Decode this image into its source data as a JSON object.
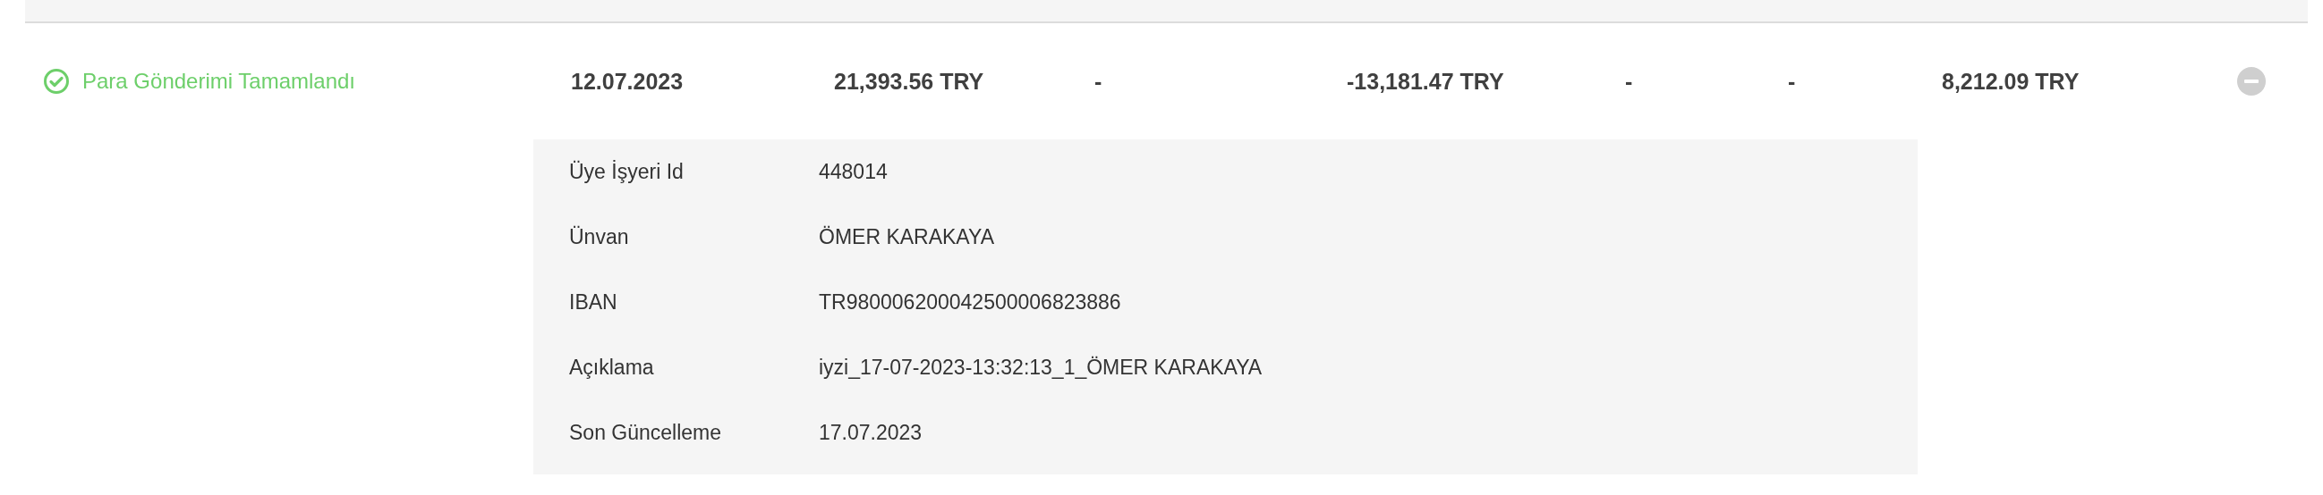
{
  "row": {
    "status": {
      "kind": "completed",
      "label": "Para Gönderimi Tamamlandı"
    },
    "cells": [
      "12.07.2023",
      "21,393.56 TRY",
      "-",
      "-13,181.47 TRY",
      "-",
      "-",
      "8,212.09 TRY"
    ],
    "expanded": true
  },
  "details": [
    {
      "label": "Üye İşyeri Id",
      "value": "448014"
    },
    {
      "label": "Ünvan",
      "value": "ÖMER KARAKAYA"
    },
    {
      "label": "IBAN",
      "value": "TR980006200042500006823886"
    },
    {
      "label": "Açıklama",
      "value": "iyzi_17-07-2023-13:32:13_1_ÖMER KARAKAYA"
    },
    {
      "label": "Son Güncelleme",
      "value": "17.07.2023"
    }
  ]
}
